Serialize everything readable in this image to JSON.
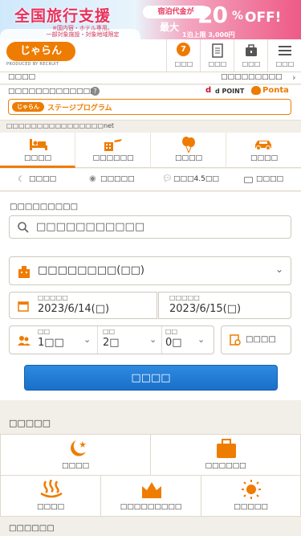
{
  "banner": {
    "title": "全国旅行支援",
    "note_line1": "※国内宿・ホテル専用。",
    "note_line2": "一部対象施設・対象地域限定",
    "pill": "宿泊代金が",
    "prefix": "最大",
    "amount": "20",
    "percent": "%",
    "off": "OFF!",
    "limit": "1泊上限 3,000円"
  },
  "header": {
    "logo": "じゃらん",
    "logo_sub": "PRODUCED BY RECRUIT",
    "notification_count": "7",
    "buttons": [
      "□□□",
      "□□□",
      "□□□"
    ]
  },
  "strip": {
    "left": "□□□□",
    "right": "□□□□□□□□□"
  },
  "points": {
    "label": "□□□□□□□□□□□□□",
    "dpoint": "d POINT",
    "ponta": "Ponta",
    "stage": "ステージプログラム"
  },
  "notice": "□□□□□□□□□□□□□□□□net",
  "tabs": [
    "□□□□",
    "□□□□□□",
    "□□□□",
    "□□□□"
  ],
  "subtabs": [
    "□□□□",
    "□□□□□",
    "□□□4.5□□",
    "□□□□"
  ],
  "form": {
    "dest_label": "□□□□□□□□□",
    "search_placeholder": "□□□□□□□□□□□",
    "dest_select": "□□□□□□□□(□□)",
    "checkin_label": "□□□□□",
    "checkin": "2023/6/14(□)",
    "checkout_label": "□□□□□",
    "checkout": "2023/6/15(□)",
    "rooms_label": "□□",
    "rooms": "1□□",
    "adults_label": "□□",
    "adults": "2□",
    "children_label": "□□",
    "children": "0□",
    "detail": "□□□□",
    "submit": "□□□□"
  },
  "categories": {
    "title": "□□□□□",
    "items": [
      "□□□□",
      "□□□□□□",
      "□□□□",
      "□□□□□□□□□",
      "□□□□□"
    ]
  },
  "footer_title": "□□□□□□",
  "colors": {
    "accent": "#ee7c00",
    "search_button": "#1f78d1"
  }
}
